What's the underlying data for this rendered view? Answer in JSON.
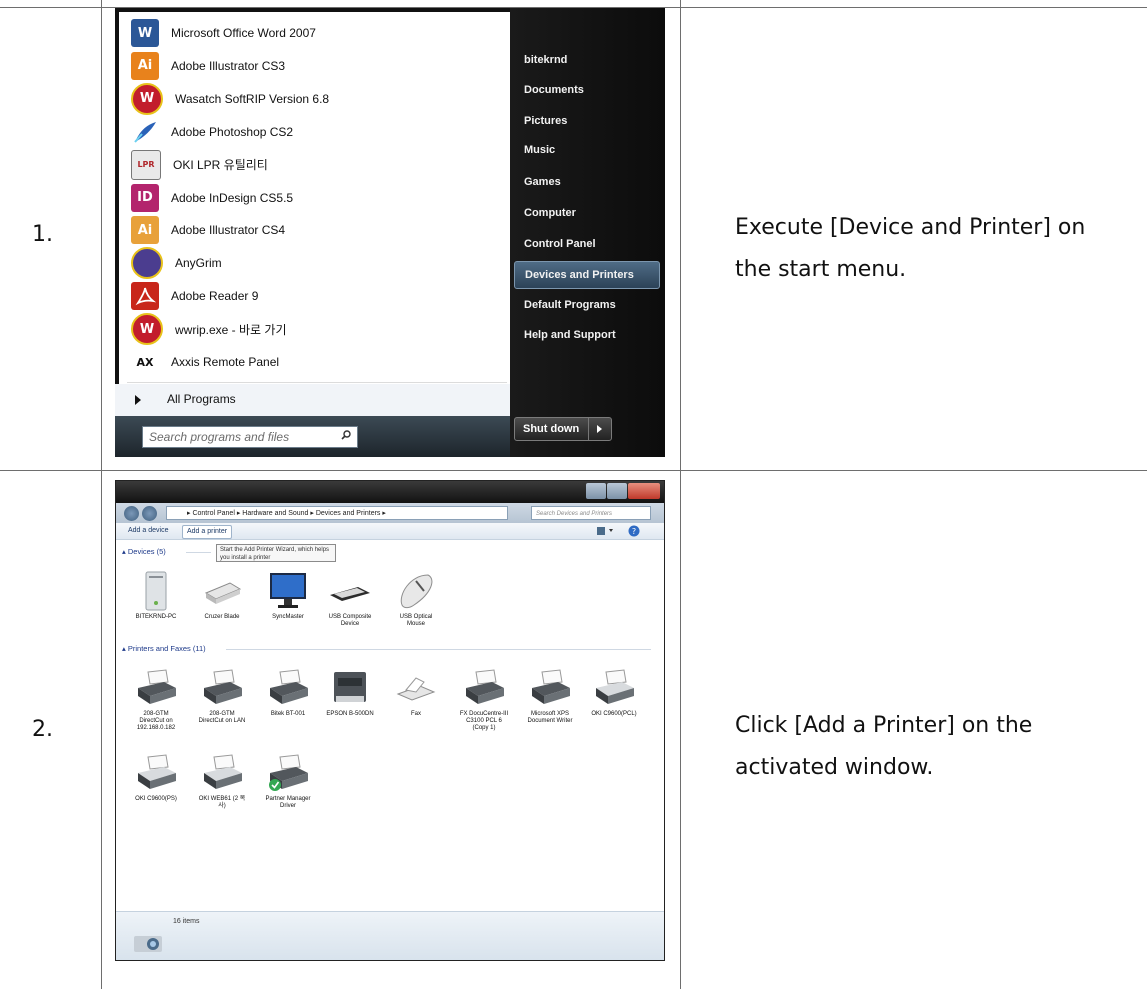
{
  "steps": [
    {
      "number": "1.",
      "description": [
        "Execute [Device and Printer] on",
        "the start menu."
      ],
      "start_menu": {
        "pinned_programs": [
          {
            "label": "Microsoft Office Word 2007",
            "icon": "word-icon",
            "icon_text": "W",
            "color": "#2b5797"
          },
          {
            "label": "Adobe Illustrator CS3",
            "icon": "illustrator-icon",
            "icon_text": "Ai",
            "color": "#e8821c"
          },
          {
            "label": "Wasatch SoftRIP Version 6.8",
            "icon": "wasatch-icon",
            "icon_text": "W",
            "color": "#c21d2c"
          },
          {
            "label": "Adobe Photoshop CS2",
            "icon": "photoshop-feather-icon",
            "icon_text": "",
            "color": "#2a62b8"
          },
          {
            "label": "OKI LPR 유틸리티",
            "icon": "printer-icon",
            "icon_text": "LPR",
            "color": "#8a8a8a"
          },
          {
            "label": "Adobe InDesign CS5.5",
            "icon": "indesign-icon",
            "icon_text": "ID",
            "color": "#b3246d"
          },
          {
            "label": "Adobe Illustrator CS4",
            "icon": "illustrator-icon",
            "icon_text": "Ai",
            "color": "#e8a13a"
          },
          {
            "label": "AnyGrim",
            "icon": "anygrim-icon",
            "icon_text": "",
            "color": "#4b3d8f"
          },
          {
            "label": "Adobe Reader 9",
            "icon": "acrobat-icon",
            "icon_text": "",
            "color": "#c8261a"
          },
          {
            "label": "wwrip.exe - 바로 가기",
            "icon": "wasatch-icon",
            "icon_text": "W",
            "color": "#c21d2c"
          },
          {
            "label": "Axxis Remote Panel",
            "icon": "axxis-cutter-icon",
            "icon_text": "AX",
            "color": "#ffffff"
          }
        ],
        "all_programs": "All Programs",
        "search_placeholder": "Search programs and files",
        "right_items": [
          {
            "label": "bitekrnd",
            "selected": false
          },
          {
            "label": "Documents",
            "selected": false
          },
          {
            "label": "Pictures",
            "selected": false
          },
          {
            "label": "Music",
            "selected": false
          },
          {
            "label": "Games",
            "selected": false
          },
          {
            "label": "Computer",
            "selected": false
          },
          {
            "label": "Control Panel",
            "selected": false
          },
          {
            "label": "Devices and Printers",
            "selected": true
          },
          {
            "label": "Default Programs",
            "selected": false
          },
          {
            "label": "Help and Support",
            "selected": false
          }
        ],
        "shutdown": "Shut down"
      }
    },
    {
      "number": "2.",
      "description": [
        "Click [Add a Printer] on the",
        "activated window."
      ],
      "devices_window": {
        "breadcrumb": "▸ Control Panel ▸ Hardware and Sound ▸ Devices and Printers ▸",
        "search_placeholder": "Search Devices and Printers",
        "toolbar": [
          "Add a device",
          "Add a printer"
        ],
        "tooltip": "Start the Add Printer Wizard, which helps you install a printer",
        "devices_group": "Devices (5)",
        "devices": [
          {
            "label": "BITEKRND-PC",
            "icon": "computer-tower-icon"
          },
          {
            "label": "Cruzer Blade",
            "icon": "usb-drive-icon"
          },
          {
            "label": "SyncMaster",
            "icon": "monitor-icon"
          },
          {
            "label": "USB Composite\nDevice",
            "icon": "keyboard-icon"
          },
          {
            "label": "USB Optical\nMouse",
            "icon": "mouse-icon"
          }
        ],
        "printers_group": "Printers and Faxes (11)",
        "printers": [
          {
            "label": "208-GTM\nDirectCut on\n192.168.0.182",
            "icon": "printer-icon"
          },
          {
            "label": "208-GTM\nDirectCut on LAN",
            "icon": "printer-icon"
          },
          {
            "label": "Bitek BT-001",
            "icon": "printer-icon"
          },
          {
            "label": "EPSON B-500DN",
            "icon": "epson-printer-icon"
          },
          {
            "label": "Fax",
            "icon": "fax-icon"
          },
          {
            "label": "FX DocuCentre-III\nC3100 PCL 6\n(Copy 1)",
            "icon": "printer-icon"
          },
          {
            "label": "Microsoft XPS\nDocument Writer",
            "icon": "printer-icon"
          },
          {
            "label": "OKI C9600(PCL)",
            "icon": "printer-light-icon"
          },
          {
            "label": "OKI C9600(PS)",
            "icon": "printer-light-icon"
          },
          {
            "label": "OKI WEB61 (2 복\n사)",
            "icon": "printer-light-icon"
          },
          {
            "label": "Partner Manager\nDriver",
            "icon": "printer-default-icon"
          }
        ],
        "status_count": "16 items"
      }
    }
  ]
}
